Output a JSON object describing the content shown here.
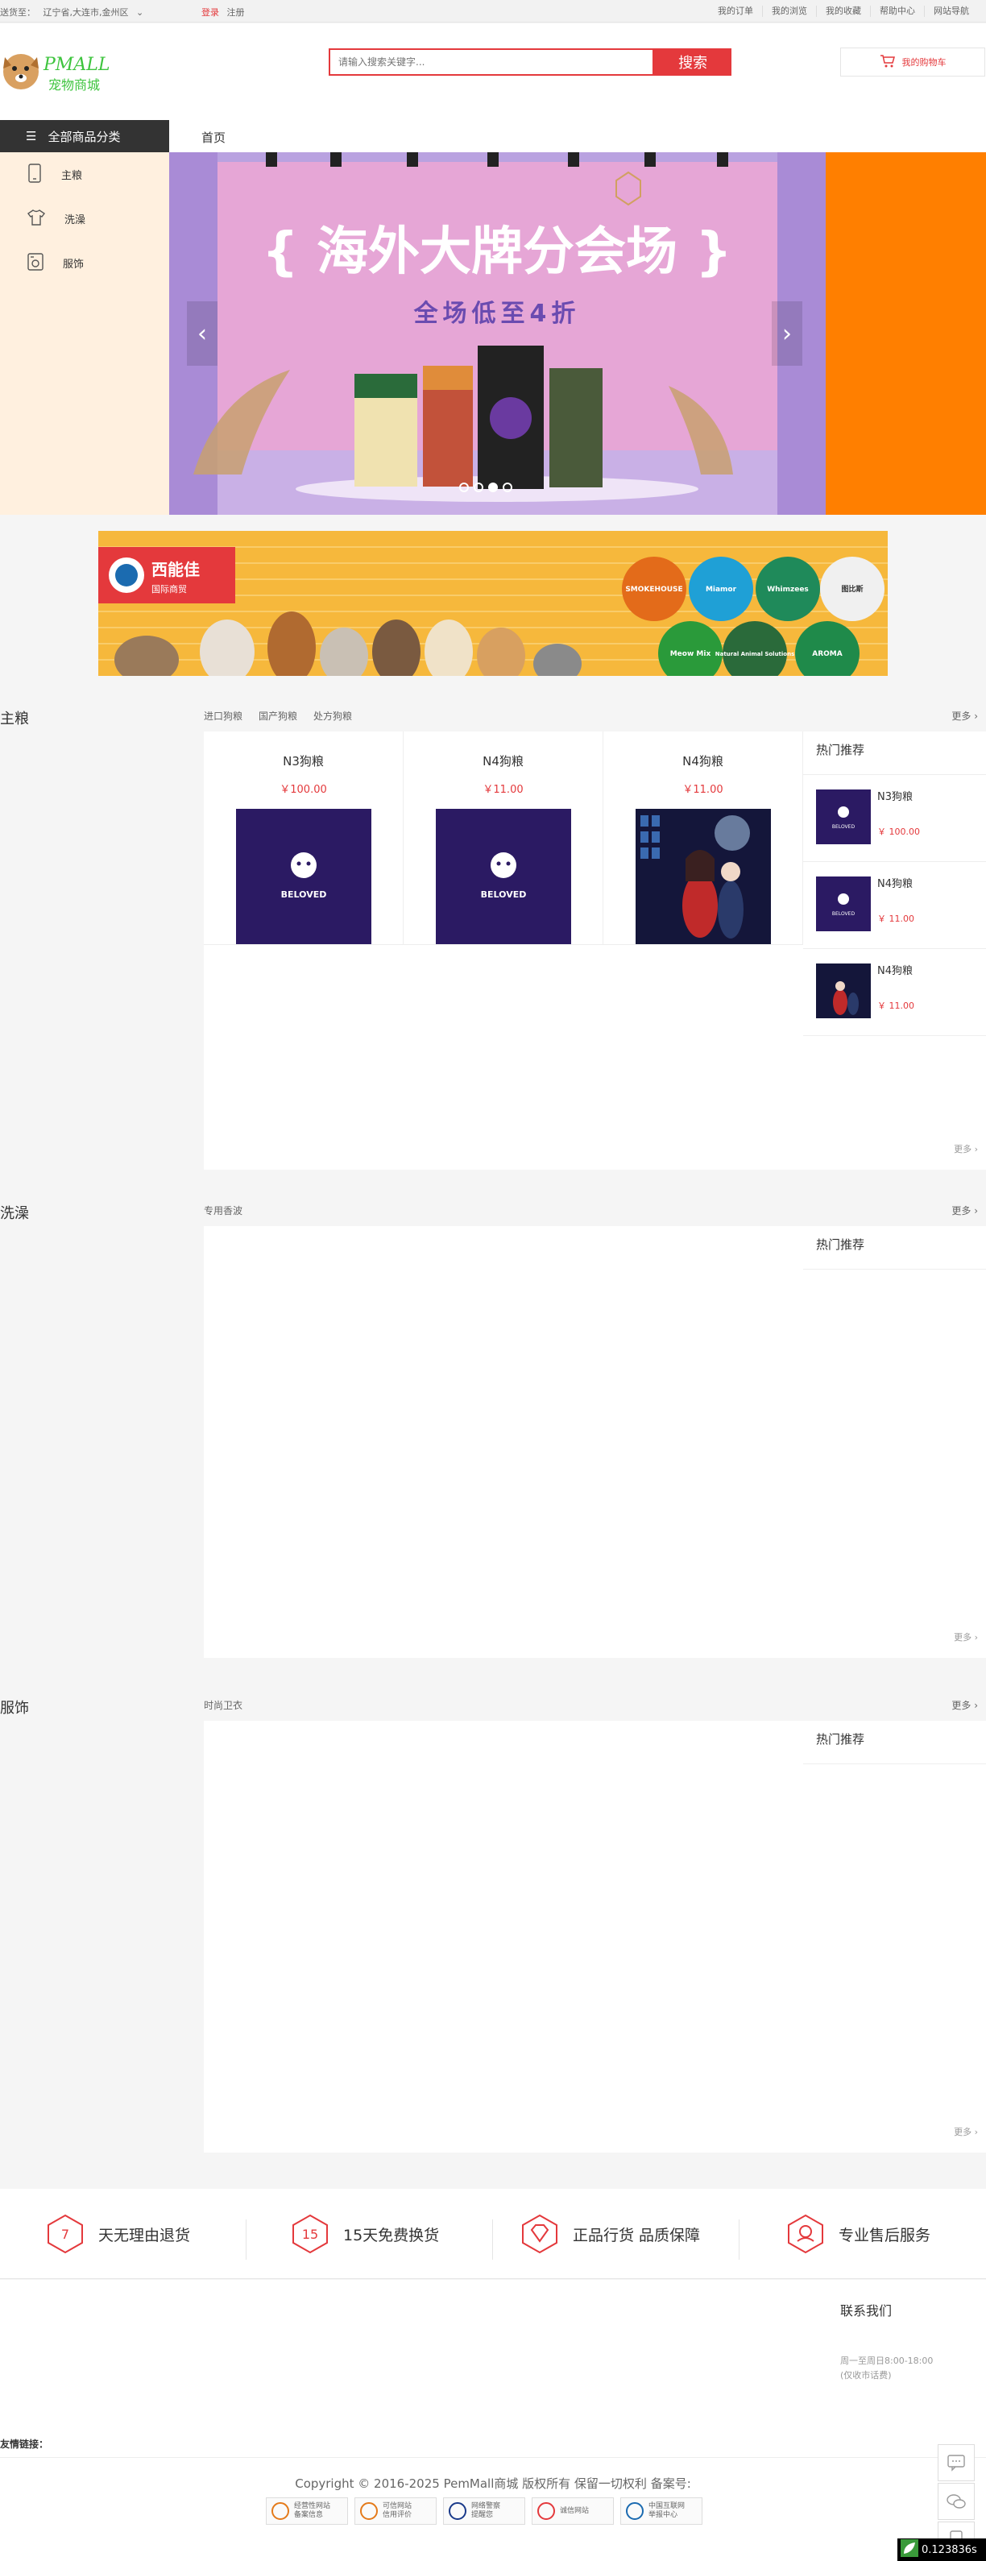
{
  "topbar": {
    "ship_label": "送货至：",
    "location": "辽宁省,大连市,金州区",
    "login": "登录",
    "register": "注册",
    "links": [
      "我的订单",
      "我的浏览",
      "我的收藏",
      "帮助中心",
      "网站导航"
    ]
  },
  "header": {
    "logo_text": "PMALL",
    "logo_sub": "宠物商城",
    "search_placeholder": "请输入搜索关键字...",
    "search_button": "搜索",
    "cart_label": "我的购物车"
  },
  "nav": {
    "all_categories": "全部商品分类",
    "home": "首页"
  },
  "sidebar": {
    "items": [
      {
        "label": "主粮",
        "icon": "phone-icon"
      },
      {
        "label": "洗澡",
        "icon": "shirt-icon"
      },
      {
        "label": "服饰",
        "icon": "appliance-icon"
      }
    ]
  },
  "hero": {
    "headline": "{ 海外大牌分会场 }",
    "subline": "全场低至4折",
    "active_slide": 2,
    "slide_count": 4
  },
  "ad": {
    "brand": "西能佳",
    "brand_sub": "国际商贸",
    "logos": [
      "SMOKEHOUSE",
      "Miamor",
      "Whimzees",
      "图比斯",
      "Meow Mix",
      "Natural Animal Solutions",
      "AROMA"
    ]
  },
  "floors": [
    {
      "title": "主粮",
      "tabs": [
        "进口狗粮",
        "国产狗粮",
        "处方狗粮"
      ],
      "more": "更多",
      "products": [
        {
          "name": "N3狗粮",
          "price": "￥100.00",
          "image": "beloved"
        },
        {
          "name": "N4狗粮",
          "price": "￥11.00",
          "image": "beloved"
        },
        {
          "name": "N4狗粮",
          "price": "￥11.00",
          "image": "anime"
        }
      ],
      "hot_title": "热门推荐",
      "hot": [
        {
          "name": "N3狗粮",
          "price": "￥ 100.00",
          "image": "beloved"
        },
        {
          "name": "N4狗粮",
          "price": "￥ 11.00",
          "image": "beloved"
        },
        {
          "name": "N4狗粮",
          "price": "￥ 11.00",
          "image": "anime"
        }
      ],
      "more_bottom": "更多"
    },
    {
      "title": "洗澡",
      "tabs": [
        "专用香波"
      ],
      "more": "更多",
      "hot_title": "热门推荐",
      "more_bottom": "更多"
    },
    {
      "title": "服饰",
      "tabs": [
        "时尚卫衣"
      ],
      "more": "更多",
      "hot_title": "热门推荐",
      "more_bottom": "更多"
    }
  ],
  "services": [
    {
      "num": "7",
      "label": "天无理由退货"
    },
    {
      "num": "15",
      "label": "15天免费换货"
    },
    {
      "num": "",
      "label": "正品行货 品质保障"
    },
    {
      "num": "",
      "label": "专业售后服务"
    }
  ],
  "footer": {
    "contact": "联系我们",
    "hours": "周一至周日8:00-18:00",
    "hours_note": "(仅收市话费)",
    "friend_links": "友情链接：",
    "copyright": "Copyright © 2016-2025 PemMall商城 版权所有 保留一切权利 备案号:",
    "badges": [
      {
        "l1": "经营性网站",
        "l2": "备案信息"
      },
      {
        "l1": "可信网站",
        "l2": "信用评价"
      },
      {
        "l1": "网络警察",
        "l2": "提醒您"
      },
      {
        "l1": "诚信网站",
        "l2": ""
      },
      {
        "l1": "中国互联网",
        "l2": "举报中心"
      }
    ]
  },
  "timer": "0.123836s",
  "colors": {
    "accent": "#e4393c",
    "banner_bg": "#ff7f00",
    "sidebar_bg": "#fff0df",
    "dark": "#333333"
  }
}
